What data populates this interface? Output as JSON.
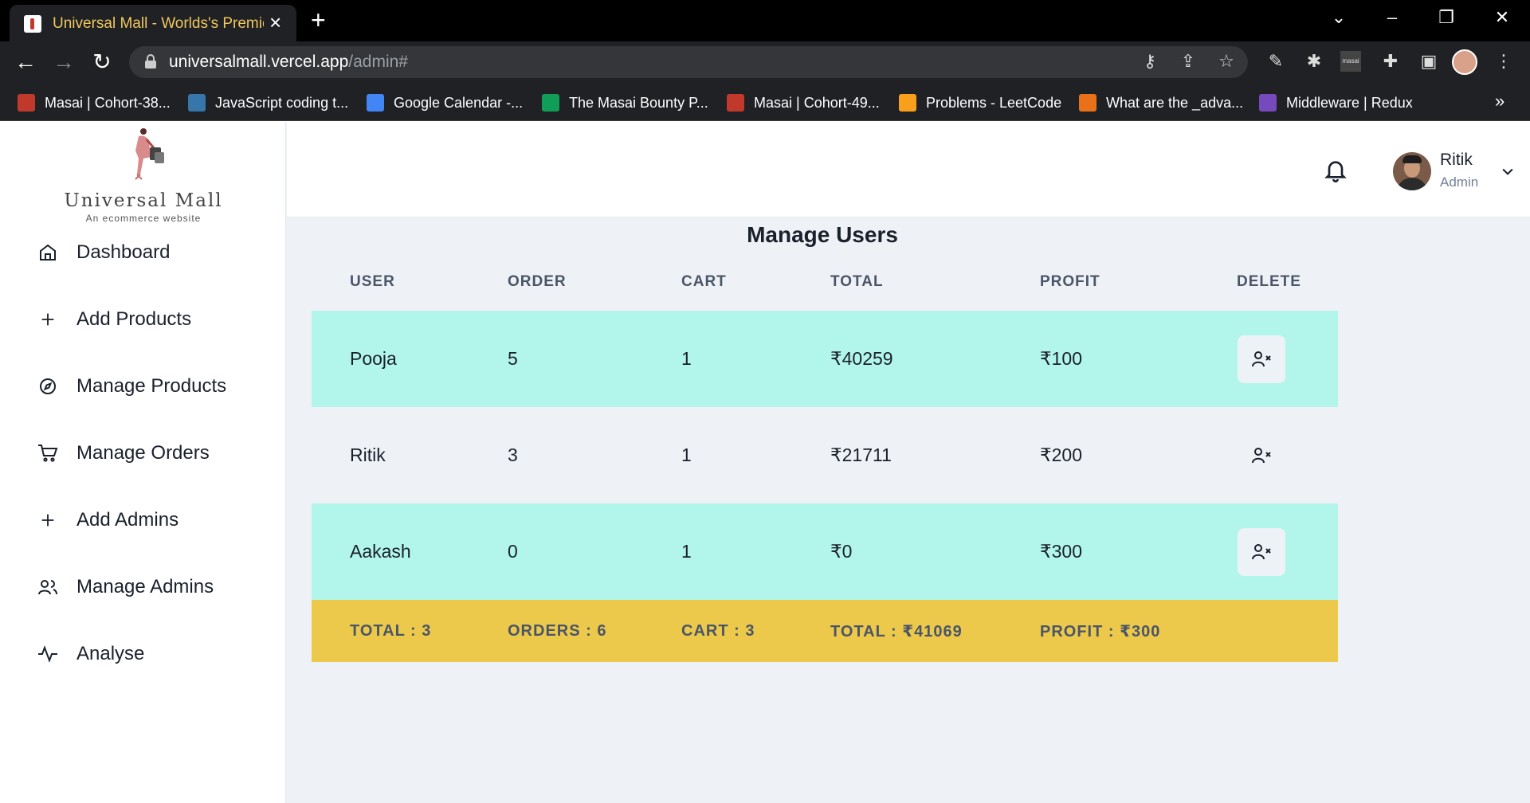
{
  "browser": {
    "tab_title": "Universal Mall - Worlds's Premier",
    "url_domain": "universalmall.vercel.app",
    "url_path": "/admin#",
    "bookmarks": [
      {
        "label": "Masai | Cohort-38...",
        "color": "#c0392b"
      },
      {
        "label": "JavaScript coding t...",
        "color": "#3776ab"
      },
      {
        "label": "Google Calendar -...",
        "color": "#4285f4"
      },
      {
        "label": "The Masai Bounty P...",
        "color": "#0f9d58"
      },
      {
        "label": "Masai | Cohort-49...",
        "color": "#c0392b"
      },
      {
        "label": "Problems - LeetCode",
        "color": "#f89f1b"
      },
      {
        "label": "What are the _adva...",
        "color": "#e8711a"
      },
      {
        "label": "Middleware | Redux",
        "color": "#764abc"
      }
    ]
  },
  "sidebar": {
    "logo_name": "Universal Mall",
    "logo_tagline": "An ecommerce website",
    "items": [
      {
        "label": "Dashboard",
        "icon": "home-icon"
      },
      {
        "label": "Add Products",
        "icon": "plus-icon"
      },
      {
        "label": "Manage Products",
        "icon": "compass-icon"
      },
      {
        "label": "Manage Orders",
        "icon": "cart-icon"
      },
      {
        "label": "Add Admins",
        "icon": "plus-icon"
      },
      {
        "label": "Manage Admins",
        "icon": "users-icon"
      },
      {
        "label": "Analyse",
        "icon": "activity-icon"
      }
    ]
  },
  "header": {
    "user_name": "Ritik",
    "user_role": "Admin"
  },
  "page": {
    "title": "Manage Users"
  },
  "table": {
    "headers": [
      "USER",
      "ORDER",
      "CART",
      "TOTAL",
      "PROFIT",
      "DELETE"
    ],
    "rows": [
      {
        "user": "Pooja",
        "order": "5",
        "cart": "1",
        "total": "₹40259",
        "profit": "₹100"
      },
      {
        "user": "Ritik",
        "order": "3",
        "cart": "1",
        "total": "₹21711",
        "profit": "₹200"
      },
      {
        "user": "Aakash",
        "order": "0",
        "cart": "1",
        "total": "₹0",
        "profit": "₹300"
      }
    ],
    "footer": {
      "total": "TOTAL : 3",
      "orders": "ORDERS : 6",
      "cart": "CART : 3",
      "grand_total": "TOTAL : ₹41069",
      "profit": "PROFIT : ₹300"
    }
  },
  "colors": {
    "row_highlight": "#b2f5ea",
    "footer_bg": "#ecc94b",
    "page_bg": "#eef2f6",
    "delete_btn_bg": "#edf2f7"
  }
}
